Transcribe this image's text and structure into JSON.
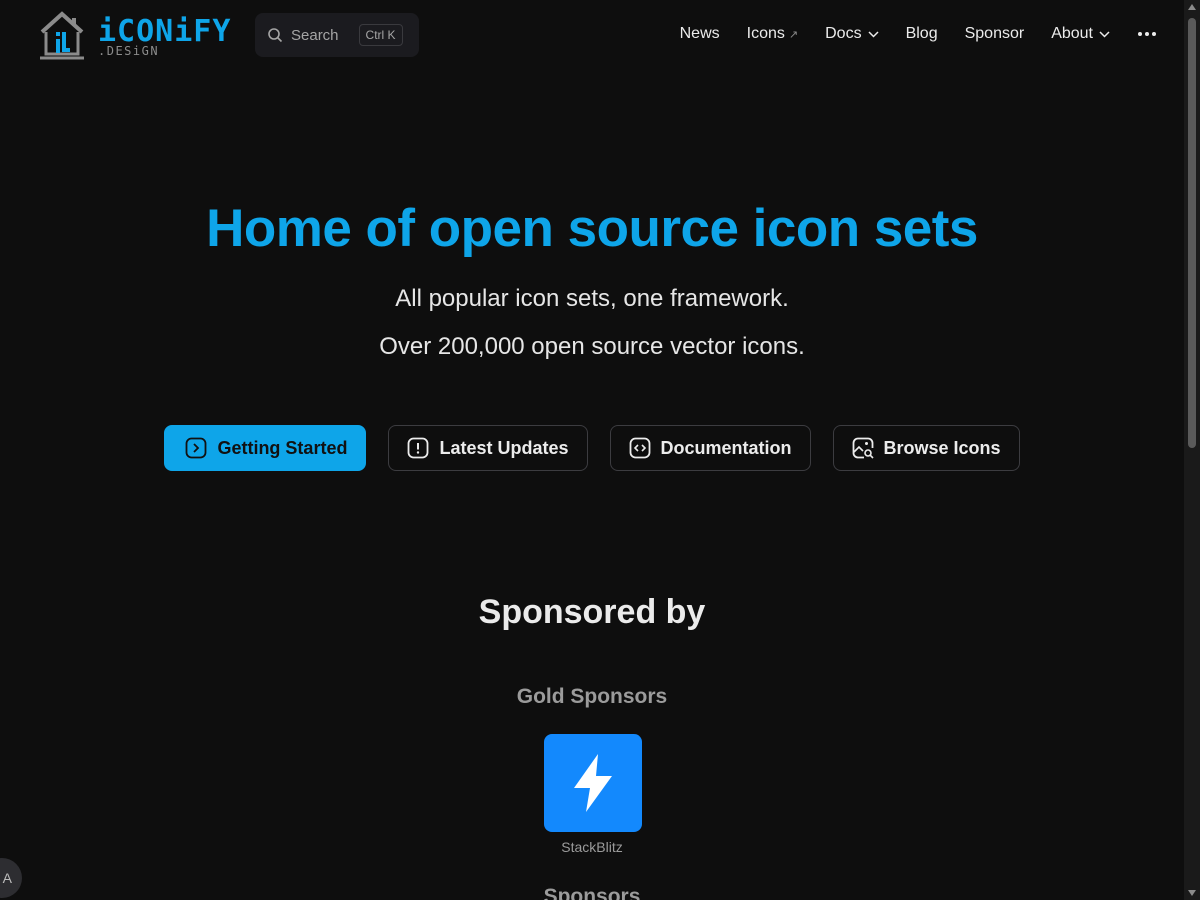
{
  "brand": {
    "logo_text": "iCONiFY",
    "logo_sub": ".DESiGN"
  },
  "search": {
    "label": "Search",
    "shortcut": "Ctrl K"
  },
  "nav": {
    "items": [
      {
        "label": "News"
      },
      {
        "label": "Icons",
        "external": "↗"
      },
      {
        "label": "Docs"
      },
      {
        "label": "Blog"
      },
      {
        "label": "Sponsor"
      },
      {
        "label": "About"
      }
    ]
  },
  "hero": {
    "title": "Home of open source icon sets",
    "tagline_1": "All popular icon sets, one framework.",
    "tagline_2": "Over 200,000 open source vector icons."
  },
  "actions": [
    {
      "label": "Getting Started",
      "icon": "chevron-right-square-icon"
    },
    {
      "label": "Latest Updates",
      "icon": "alert-square-icon"
    },
    {
      "label": "Documentation",
      "icon": "code-square-icon"
    },
    {
      "label": "Browse Icons",
      "icon": "image-search-icon"
    }
  ],
  "sponsors": {
    "heading": "Sponsored by",
    "gold_label": "Gold Sponsors",
    "gold": [
      {
        "name": "StackBlitz",
        "icon": "lightning-bolt-icon"
      }
    ],
    "next_label": "Sponsors"
  },
  "colors": {
    "accent": "#0ea5e9",
    "background": "#0e0e0e",
    "stackblitz": "#1389fd"
  },
  "translate_button": "A"
}
